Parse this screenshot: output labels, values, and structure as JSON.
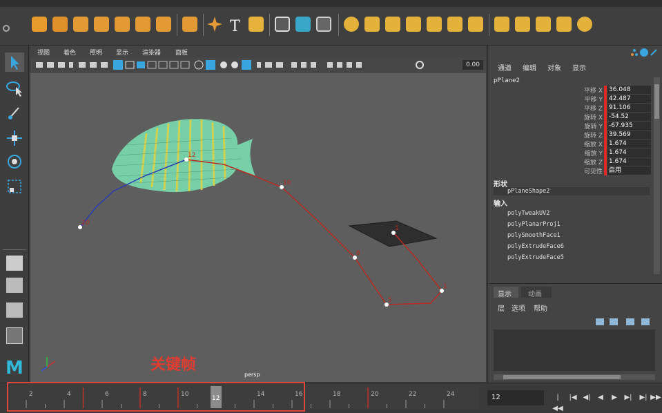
{
  "viewport": {
    "menu": [
      "视图",
      "着色",
      "照明",
      "显示",
      "渲染器",
      "面板"
    ],
    "zoom_value": "0.00",
    "camera_label": "persp",
    "curve_labels": [
      "1",
      "5",
      "8",
      "10",
      "12",
      "20"
    ]
  },
  "channel_box": {
    "tabs": [
      "通道",
      "编辑",
      "对象",
      "显示"
    ],
    "object_name": "pPlane2",
    "attributes": [
      {
        "label": "平移 X",
        "value": "36.048"
      },
      {
        "label": "平移 Y",
        "value": "42.487"
      },
      {
        "label": "平移 Z",
        "value": "91.106"
      },
      {
        "label": "旋转 X",
        "value": "-54.52"
      },
      {
        "label": "旋转 Y",
        "value": "-67.935"
      },
      {
        "label": "旋转 Z",
        "value": "39.569"
      },
      {
        "label": "缩放 X",
        "value": "1.674"
      },
      {
        "label": "缩放 Y",
        "value": "1.674"
      },
      {
        "label": "缩放 Z",
        "value": "1.674"
      },
      {
        "label": "可见性",
        "value": "启用"
      }
    ],
    "shape_header": "形状",
    "shape_node": "pPlaneShape2",
    "inputs_header": "输入",
    "input_nodes": [
      "polyTweakUV2",
      "polyPlanarProj1",
      "polySmoothFace1",
      "polyExtrudeFace6",
      "polyExtrudeFace5"
    ]
  },
  "layer_editor": {
    "tabs": [
      "显示",
      "动画"
    ],
    "menu": [
      "层",
      "选项",
      "帮助"
    ]
  },
  "time_slider": {
    "ticks": [
      "2",
      "4",
      "6",
      "8",
      "10",
      "12",
      "14",
      "16",
      "18",
      "20",
      "22",
      "24"
    ],
    "current_frame": "12",
    "current_time_field": "12"
  },
  "annotation": {
    "label": "关键帧",
    "color": "#e03c30"
  },
  "colors": {
    "motion_path": "#b82a22",
    "motion_path_blue": "#2a3cb0",
    "fish_body": "#7be3b5",
    "fish_stripes": "#d9d24a",
    "attr_bar": "#e02828"
  },
  "icons": {
    "toolbox": [
      "select-arrow-icon",
      "lasso-select-icon",
      "paint-select-icon",
      "move-tool-icon",
      "rotate-tool-icon",
      "scale-tool-icon"
    ],
    "playback": [
      "go-to-start-icon",
      "step-back-key-icon",
      "step-back-frame-icon",
      "play-back-icon",
      "play-forward-icon",
      "step-forward-frame-icon",
      "step-forward-key-icon"
    ]
  }
}
